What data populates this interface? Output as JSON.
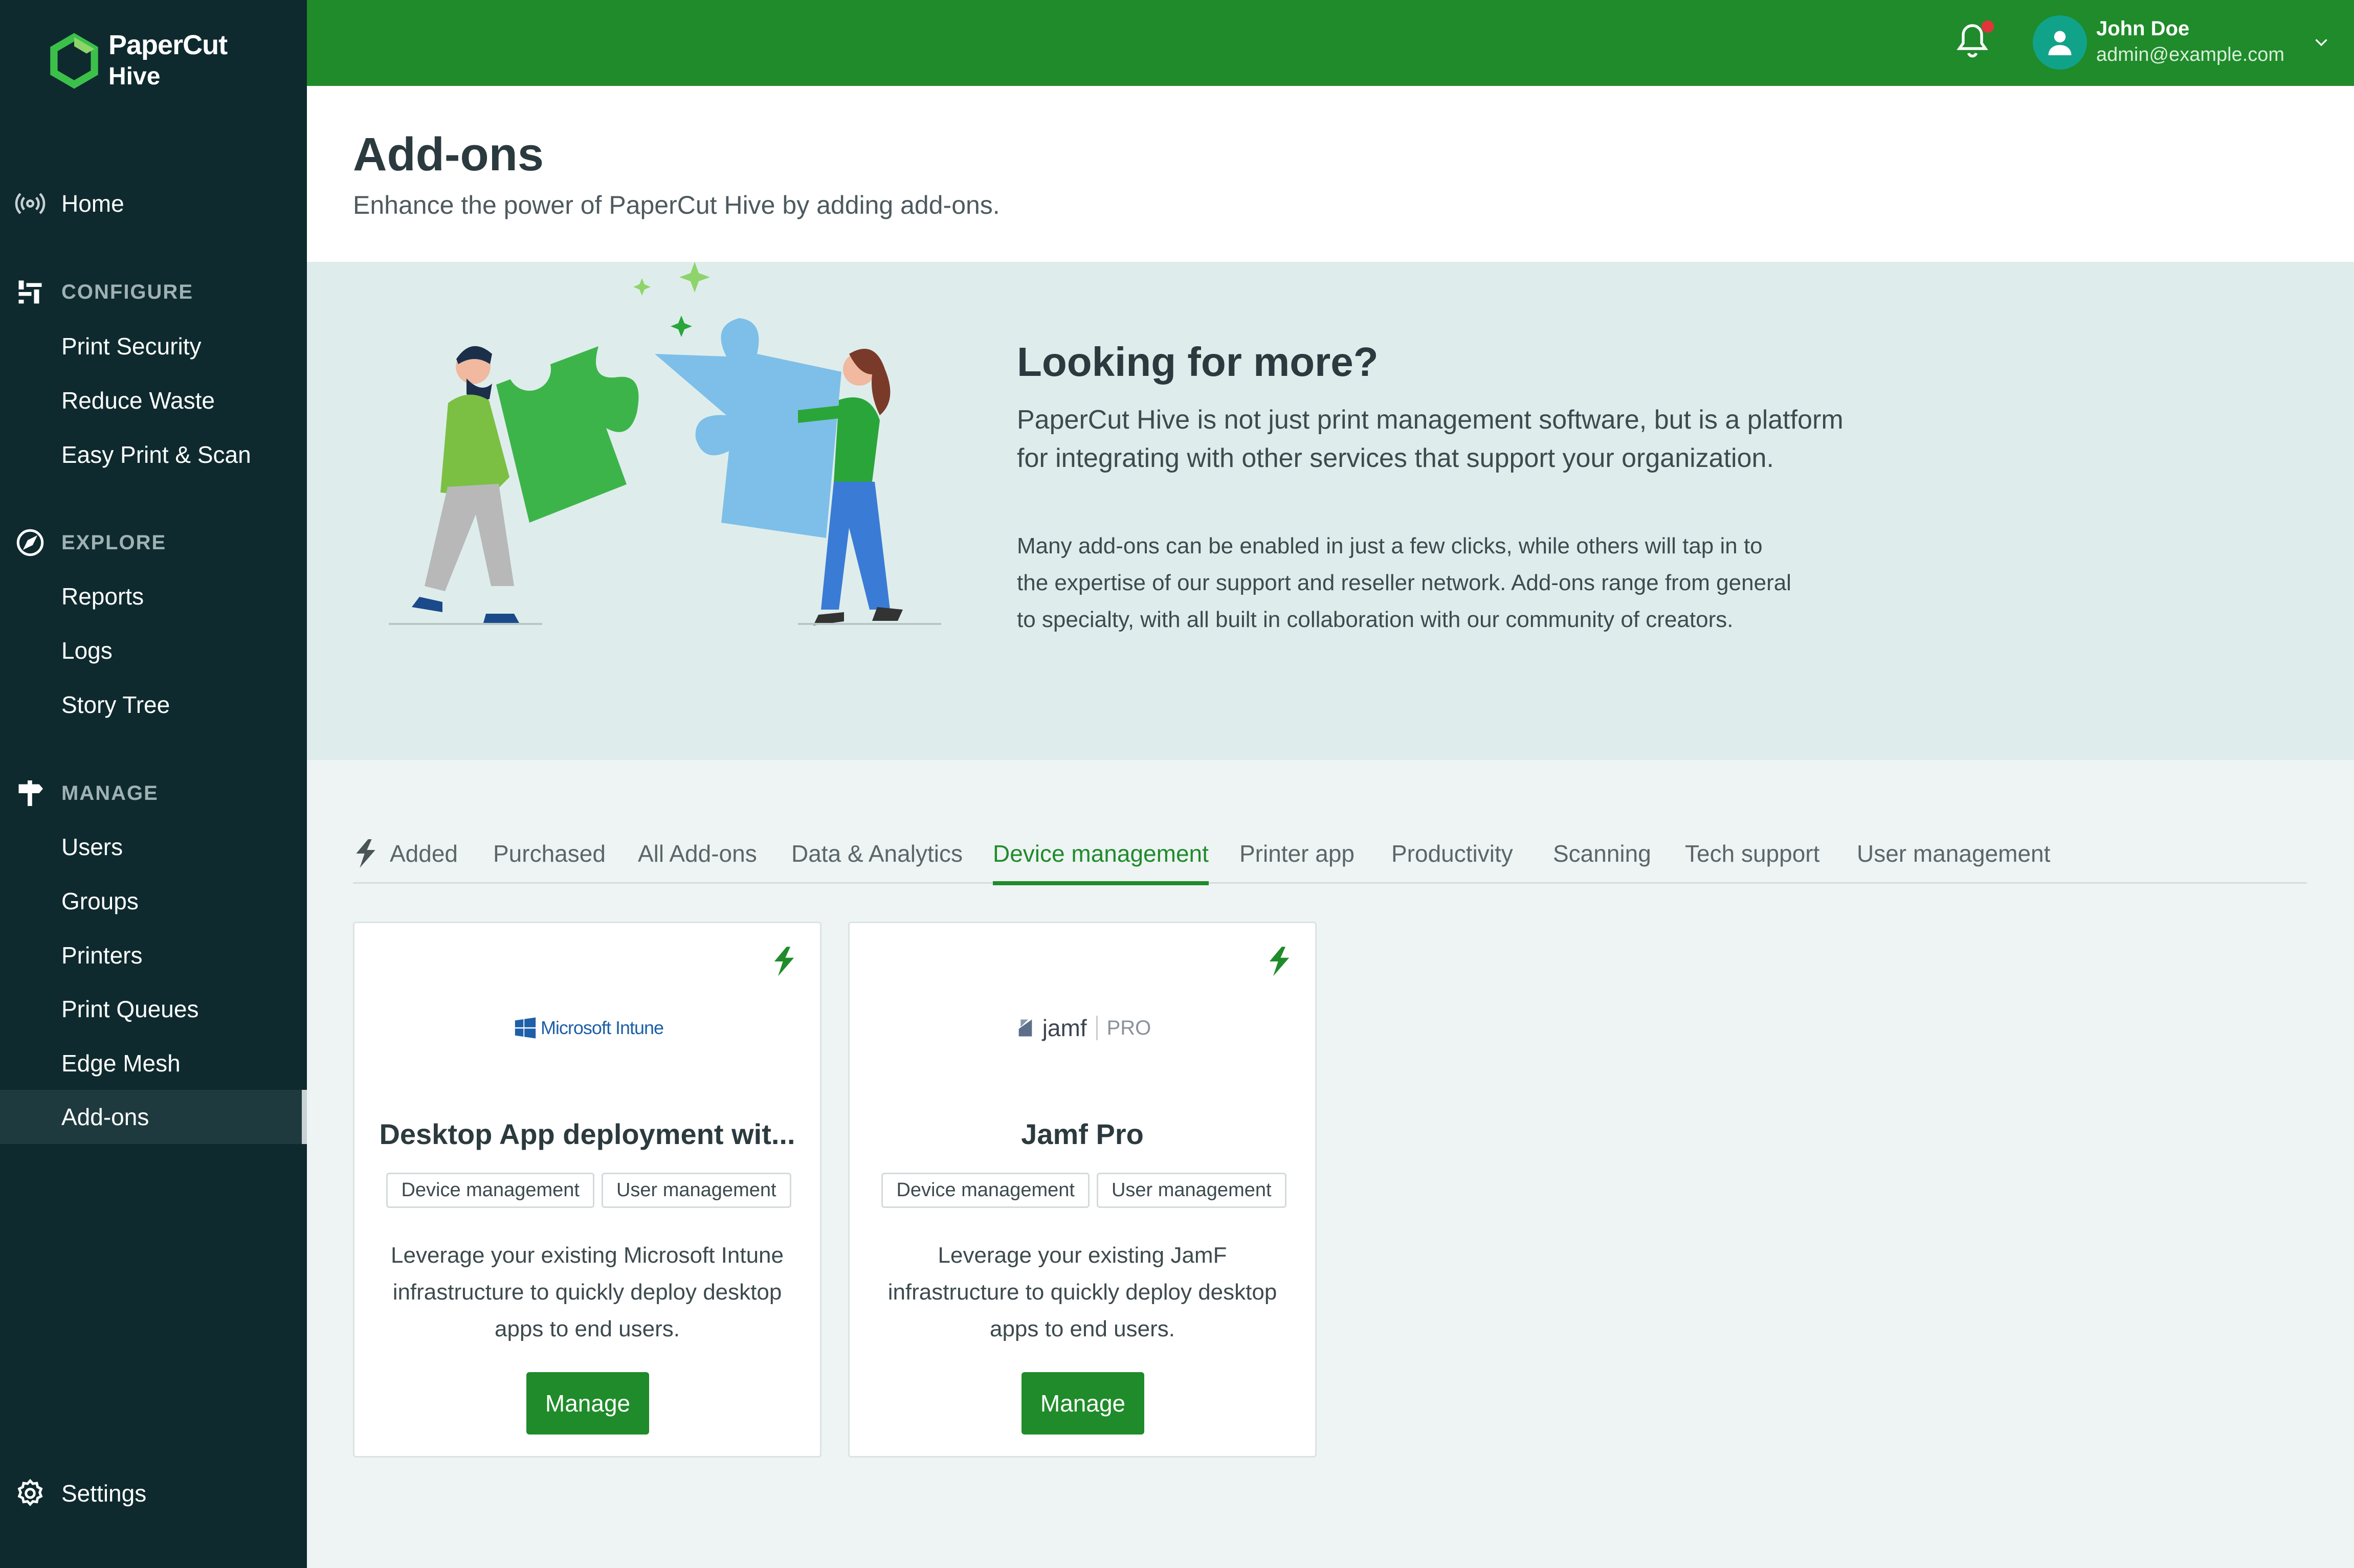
{
  "brand": {
    "line1": "PaperCut",
    "line2": "Hive"
  },
  "sidebar": {
    "home": "Home",
    "configure": {
      "title": "CONFIGURE",
      "items": [
        "Print Security",
        "Reduce Waste",
        "Easy Print & Scan"
      ]
    },
    "explore": {
      "title": "EXPLORE",
      "items": [
        "Reports",
        "Logs",
        "Story Tree"
      ]
    },
    "manage": {
      "title": "MANAGE",
      "items": [
        "Users",
        "Groups",
        "Printers",
        "Print Queues",
        "Edge Mesh",
        "Add-ons"
      ]
    },
    "settings": "Settings"
  },
  "user": {
    "name": "John Doe",
    "email": "admin@example.com"
  },
  "page": {
    "title": "Add-ons",
    "subtitle": "Enhance the power of PaperCut Hive by adding add-ons."
  },
  "hero": {
    "title": "Looking for more?",
    "p1": "PaperCut Hive is not just print management software, but is a platform for integrating with other services that support your organization.",
    "p2": "Many add-ons can be enabled in just a few clicks, while others will tap in to the expertise of our support and reseller network. Add-ons range from general to specialty, with all built in collaboration with our community of creators."
  },
  "tabs": [
    "Added",
    "Purchased",
    "All Add-ons",
    "Data & Analytics",
    "Device management",
    "Printer app",
    "Productivity",
    "Scanning",
    "Tech support",
    "User management"
  ],
  "active_tab": "Device management",
  "cards": [
    {
      "logo_text": "Microsoft Intune",
      "name": "Desktop App deployment wit...",
      "tags": [
        "Device management",
        "User management"
      ],
      "desc": "Leverage your existing Microsoft Intune infrastructure to quickly deploy desktop apps to end users.",
      "button": "Manage"
    },
    {
      "logo_text": "jamf",
      "logo_sub": "PRO",
      "name": "Jamf Pro",
      "tags": [
        "Device management",
        "User management"
      ],
      "desc": "Leverage your existing JamF infrastructure to quickly deploy desktop apps to end users.",
      "button": "Manage"
    }
  ],
  "colors": {
    "sidebar_bg": "#0e2a2e",
    "brand_green": "#1f8b2a",
    "hero_bg": "#deedec",
    "page_bg": "#eef3f4"
  }
}
